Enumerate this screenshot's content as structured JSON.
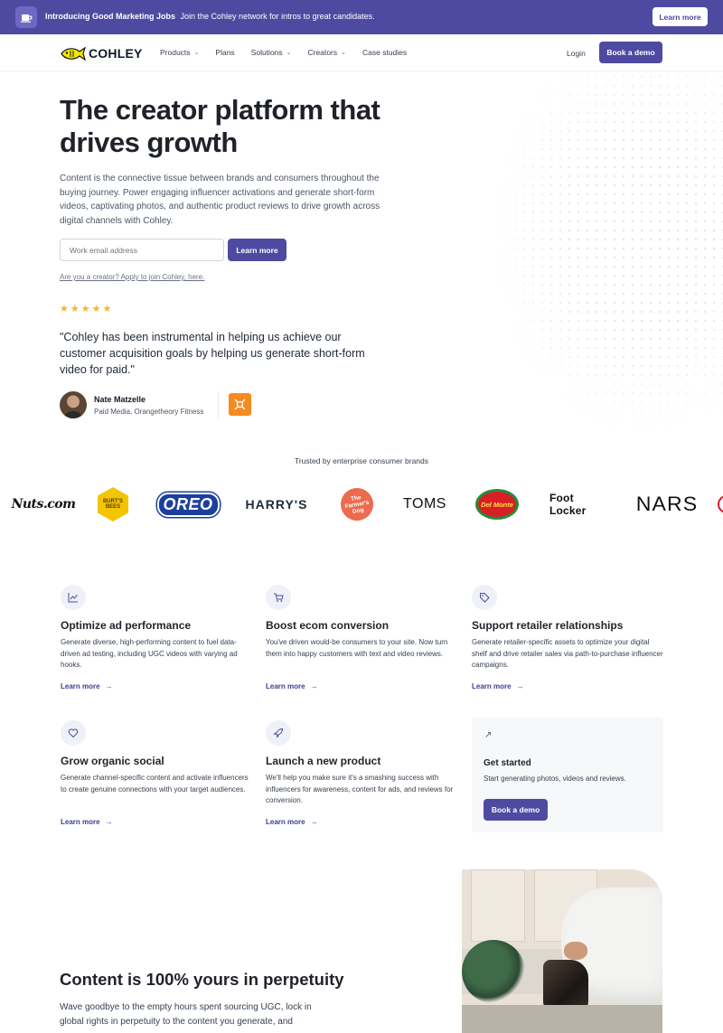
{
  "announcement": {
    "headline": "Introducing Good Marketing Jobs",
    "text": "Join the Cohley network for intros to great candidates.",
    "button": "Learn more"
  },
  "nav": {
    "logo_text": "COHLEY",
    "links": [
      {
        "label": "Products",
        "has_menu": true
      },
      {
        "label": "Plans",
        "has_menu": false
      },
      {
        "label": "Solutions",
        "has_menu": true
      },
      {
        "label": "Creators",
        "has_menu": true
      },
      {
        "label": "Case studies",
        "has_menu": false
      }
    ],
    "login": "Login",
    "demo_button": "Book a demo"
  },
  "hero": {
    "title": "The creator platform that drives growth",
    "body": "Content is the connective tissue between brands and consumers throughout the buying journey. Power engaging influencer activations and generate short-form videos, captivating photos, and authentic product reviews to drive growth across digital channels with Cohley.",
    "email_placeholder": "Work email address",
    "cta": "Learn more",
    "creator_link": "Are you a creator? Apply to join Cohley, here.",
    "rating": 5,
    "stars": "★★★★★",
    "quote": "\"Cohley has been instrumental in helping us achieve our customer acquisition goals by helping us generate short-form video for paid.\"",
    "person_name": "Nate Matzelle",
    "person_role": "Paid Media, Orangetheory Fitness"
  },
  "trusted": {
    "heading": "Trusted by enterprise consumer brands",
    "brands": [
      "Nuts.com",
      "BURT'S BEES",
      "OREO",
      "HARRY'S",
      "The Farmer's Dog",
      "TOMS",
      "Del Monte",
      "Foot Locker",
      "NARS"
    ]
  },
  "features": [
    {
      "icon": "chart-icon",
      "title": "Optimize ad performance",
      "body": "Generate diverse, high-performing content to fuel data-driven ad testing, including UGC videos with varying ad hooks.",
      "link": "Learn more"
    },
    {
      "icon": "cart-icon",
      "title": "Boost ecom conversion",
      "body": "You've driven would-be consumers to your site. Now turn them into happy customers with text and video reviews.",
      "link": "Learn more"
    },
    {
      "icon": "tag-icon",
      "title": "Support retailer relationships",
      "body": "Generate retailer-specific assets to optimize your digital shelf and drive retailer sales via path-to-purchase influencer campaigns.",
      "link": "Learn more"
    },
    {
      "icon": "heart-icon",
      "title": "Grow organic social",
      "body": "Generate channel-specific content and activate influencers to create genuine connections with your target audiences.",
      "link": "Learn more"
    },
    {
      "icon": "rocket-icon",
      "title": "Launch a new product",
      "body": "We'll help you make sure it's a smashing success with influencers for awareness, content for ads, and reviews for conversion.",
      "link": "Learn more"
    }
  ],
  "get_started": {
    "icon": "arrow-up-right-icon",
    "title": "Get started",
    "body": "Start generating photos, videos and reviews.",
    "button": "Book a demo"
  },
  "perpetuity": {
    "title": "Content is 100% yours in perpetuity",
    "body": "Wave goodbye to the empty hours spent sourcing UGC, lock in global rights in perpetuity to the content you generate, and"
  },
  "colors": {
    "brand": "#4f4aa1",
    "star": "#f5b531",
    "logo_fish": "#f2e600"
  }
}
